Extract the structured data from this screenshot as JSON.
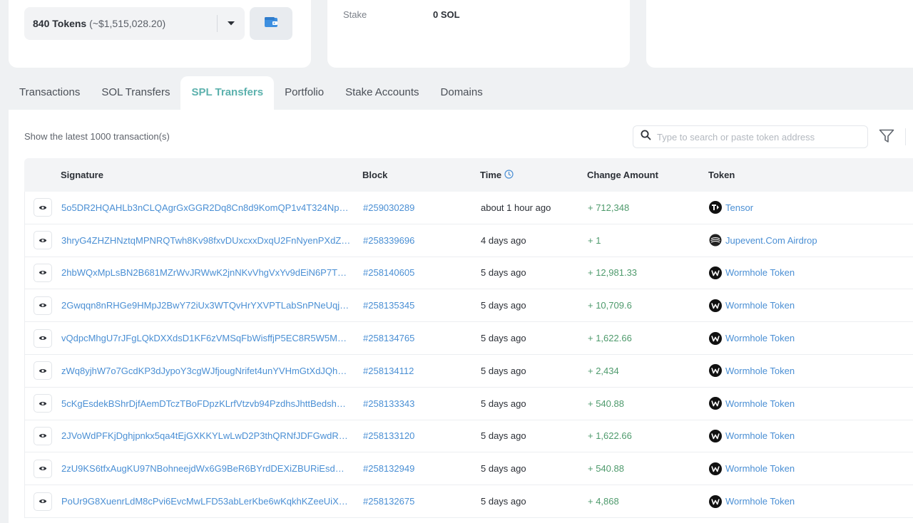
{
  "token_select": {
    "count": "840 Tokens",
    "usd": "(~$1,515,028.20)"
  },
  "stake": {
    "label": "Stake",
    "value": "0 SOL"
  },
  "tabs": [
    {
      "label": "Transactions",
      "active": false
    },
    {
      "label": "SOL Transfers",
      "active": false
    },
    {
      "label": "SPL Transfers",
      "active": true
    },
    {
      "label": "Portfolio",
      "active": false
    },
    {
      "label": "Stake Accounts",
      "active": false
    },
    {
      "label": "Domains",
      "active": false
    }
  ],
  "summary": "Show the latest 1000 transaction(s)",
  "search": {
    "placeholder": "Type to search or paste token address"
  },
  "table": {
    "headers": {
      "signature": "Signature",
      "block": "Block",
      "time": "Time",
      "change": "Change Amount",
      "token": "Token"
    },
    "rows": [
      {
        "signature": "5o5DR2HQAHLb3nCLQAgrGxGGR2Dq8Cn8d9KomQP1v4T324NpYe…",
        "block": "#259030289",
        "time": "about 1 hour ago",
        "change": "+ 712,348",
        "token": "Tensor",
        "token_icon": "tensor-icon"
      },
      {
        "signature": "3hryG4ZHZHNztqMPNRQTwh8Kv98fxvDUxcxxDxqU2FnNyenPXdZK…",
        "block": "#258339696",
        "time": "4 days ago",
        "change": "+ 1",
        "token": "Jupevent.Com Airdrop",
        "token_icon": "jupevent-icon"
      },
      {
        "signature": "2hbWQxMpLsBN2B681MZrWvJRWwK2jnNKvVhgVxYv9dEiN6P7TnC…",
        "block": "#258140605",
        "time": "5 days ago",
        "change": "+ 12,981.33",
        "token": "Wormhole Token",
        "token_icon": "wormhole-icon"
      },
      {
        "signature": "2Gwqqn8nRHGe9HMpJ2BwY72iUx3WTQvHrYXVPTLabSnPNeUqjo…",
        "block": "#258135345",
        "time": "5 days ago",
        "change": "+ 10,709.6",
        "token": "Wormhole Token",
        "token_icon": "wormhole-icon"
      },
      {
        "signature": "vQdpcMhgU7rJFgLQkDXXdsD1KF6zVMSqFbWisffjP5EC8R5W5MTH…",
        "block": "#258134765",
        "time": "5 days ago",
        "change": "+ 1,622.66",
        "token": "Wormhole Token",
        "token_icon": "wormhole-icon"
      },
      {
        "signature": "zWq8yjhW7o7GcdKP3dJypoY3cgWJfjougNrifet4unYVHmGtXdJQhA…",
        "block": "#258134112",
        "time": "5 days ago",
        "change": "+ 2,434",
        "token": "Wormhole Token",
        "token_icon": "wormhole-icon"
      },
      {
        "signature": "5cKgEsdekBShrDjfAemDTczTBoFDpzKLrfVtzvb94PzdhsJhttBedshW…",
        "block": "#258133343",
        "time": "5 days ago",
        "change": "+ 540.88",
        "token": "Wormhole Token",
        "token_icon": "wormhole-icon"
      },
      {
        "signature": "2JVoWdPFKjDghjpnkx5qa4tEjGXKKYLwLwD2P3thQRNfJDFGwdRH9…",
        "block": "#258133120",
        "time": "5 days ago",
        "change": "+ 1,622.66",
        "token": "Wormhole Token",
        "token_icon": "wormhole-icon"
      },
      {
        "signature": "2zU9KS6tfxAugKU97NBohneejdWx6G9BeR6BYrdDEXiZBURiEsdm2…",
        "block": "#258132949",
        "time": "5 days ago",
        "change": "+ 540.88",
        "token": "Wormhole Token",
        "token_icon": "wormhole-icon"
      },
      {
        "signature": "PoUr9G8XuenrLdM8cPvi6EvcMwLFD53abLerKbe6wKqkhKZeeUiXd…",
        "block": "#258132675",
        "time": "5 days ago",
        "change": "+ 4,868",
        "token": "Wormhole Token",
        "token_icon": "wormhole-icon"
      }
    ]
  },
  "colors": {
    "accent": "#5cb1ad",
    "link": "#4a8fd4",
    "positive": "#4e9a6c"
  }
}
